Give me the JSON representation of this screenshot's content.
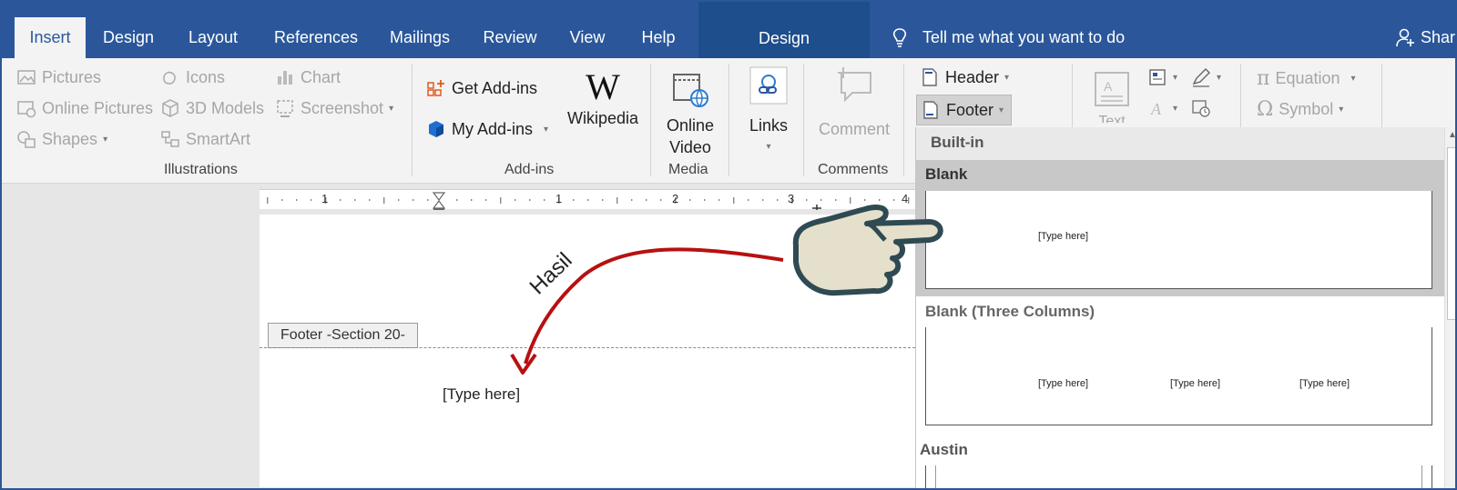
{
  "tabs": [
    "Insert",
    "Design",
    "Layout",
    "References",
    "Mailings",
    "Review",
    "View",
    "Help"
  ],
  "context_tab": "Design",
  "tell_me": "Tell me what you want to do",
  "share": "Share",
  "ribbon": {
    "illustrations": {
      "pictures": "Pictures",
      "online_pictures": "Online Pictures",
      "shapes": "Shapes",
      "icons": "Icons",
      "models": "3D Models",
      "smartart": "SmartArt",
      "chart": "Chart",
      "screenshot": "Screenshot",
      "group": "Illustrations"
    },
    "addins": {
      "get": "Get Add-ins",
      "my": "My Add-ins",
      "wikipedia": "Wikipedia",
      "group": "Add-ins"
    },
    "media": {
      "line1": "Online",
      "line2": "Video",
      "group": "Media"
    },
    "links": "Links",
    "comments": {
      "comment": "Comment",
      "group": "Comments"
    },
    "header": "Header",
    "footer": "Footer",
    "text": "Text",
    "equation": "Equation",
    "symbol": "Symbol"
  },
  "document": {
    "footer_tag": "Footer -Section 20-",
    "type_here": "[Type here]",
    "annotation": "Hasil",
    "ruler_numbers": [
      "1",
      "1",
      "2",
      "3",
      "4"
    ]
  },
  "gallery": {
    "header": "Built-in",
    "blank": "Blank",
    "blank_placeholder": "[Type here]",
    "three_columns": "Blank (Three Columns)",
    "three_placeholders": [
      "[Type here]",
      "[Type here]",
      "[Type here]"
    ],
    "austin": "Austin"
  },
  "colors": {
    "accent": "#2b579a",
    "arrow": "#b81010",
    "hand_fill": "#e4e0cc",
    "hand_stroke": "#2f4a52"
  }
}
